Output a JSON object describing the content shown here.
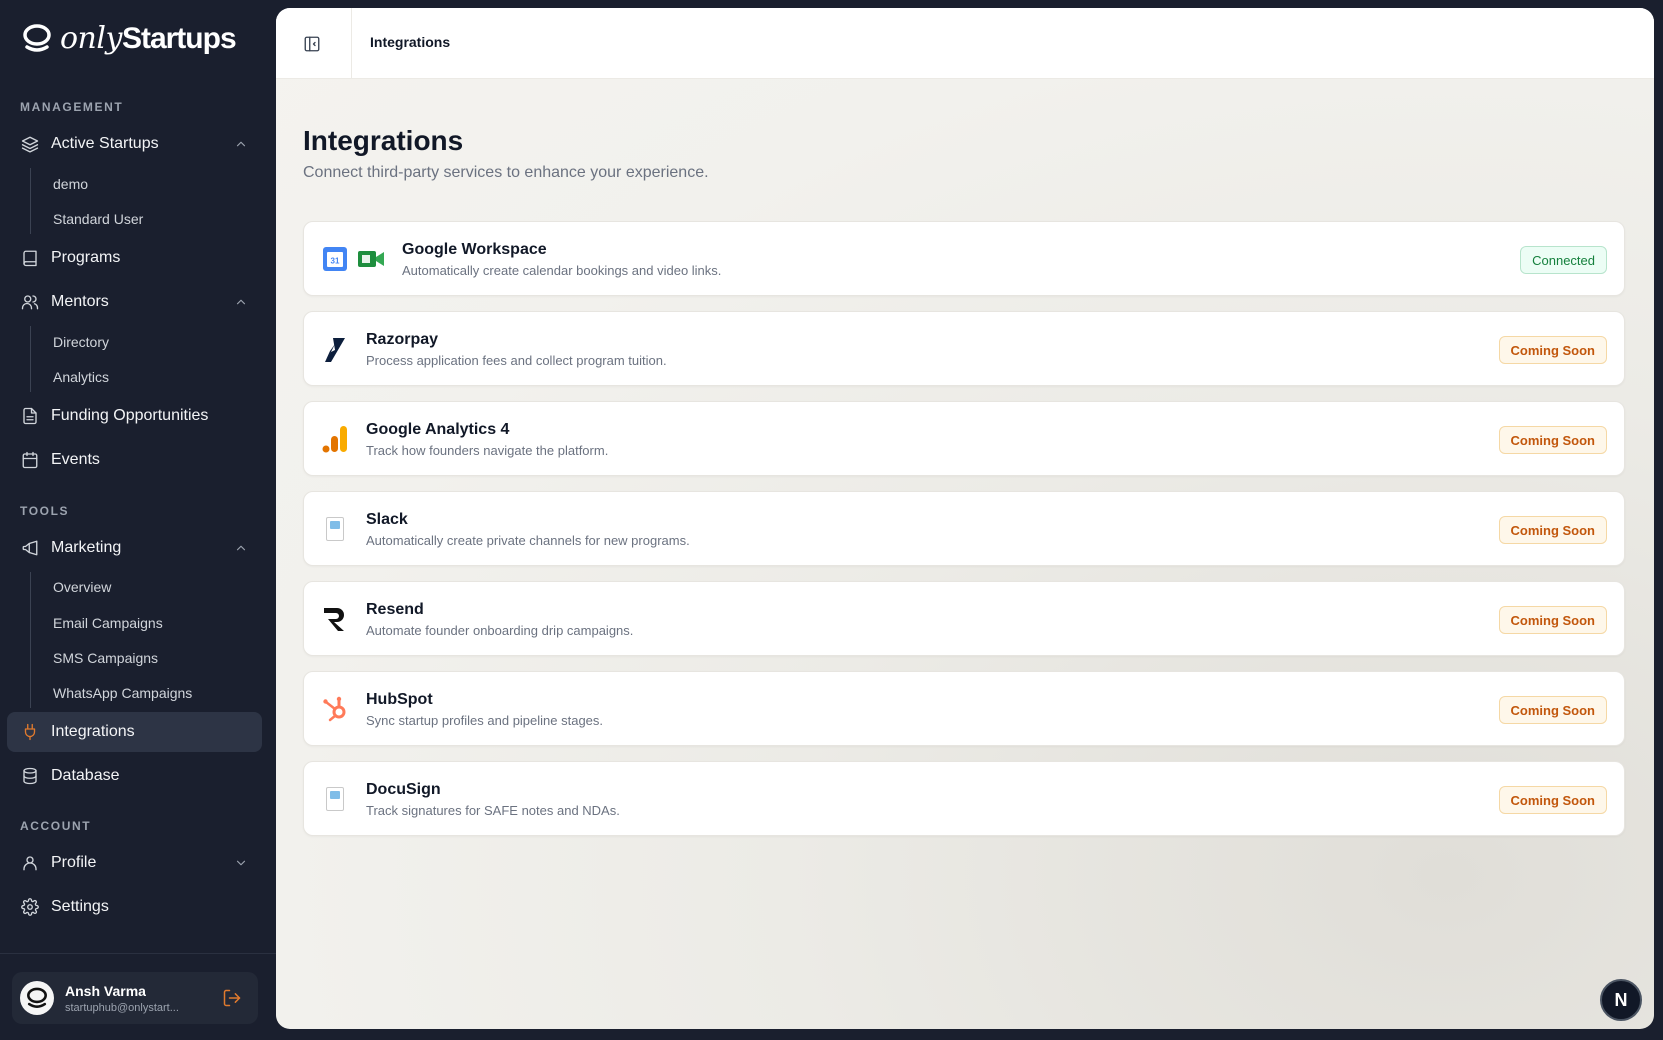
{
  "brand": {
    "only": "only",
    "startups": "Startups"
  },
  "sidebar": {
    "sections": {
      "management": "MANAGEMENT",
      "tools": "TOOLS",
      "account": "ACCOUNT"
    },
    "items": {
      "active_startups": "Active Startups",
      "programs": "Programs",
      "mentors": "Mentors",
      "funding": "Funding Opportunities",
      "events": "Events",
      "marketing": "Marketing",
      "integrations": "Integrations",
      "database": "Database",
      "profile": "Profile",
      "settings": "Settings"
    },
    "sub": {
      "startups": [
        "demo",
        "Standard User"
      ],
      "mentors": [
        "Directory",
        "Analytics"
      ],
      "marketing": [
        "Overview",
        "Email Campaigns",
        "SMS Campaigns",
        "WhatsApp Campaigns"
      ]
    },
    "user": {
      "name": "Ansh Varma",
      "email": "startuphub@onlystart..."
    }
  },
  "topbar": {
    "breadcrumb": "Integrations"
  },
  "page": {
    "title": "Integrations",
    "subtitle": "Connect third-party services to enhance your experience."
  },
  "integrations": [
    {
      "name": "Google Workspace",
      "desc": "Automatically create calendar bookings and video links.",
      "status": "Connected",
      "icon": "google-calendar-meet"
    },
    {
      "name": "Razorpay",
      "desc": "Process application fees and collect program tuition.",
      "status": "Coming Soon",
      "icon": "razorpay"
    },
    {
      "name": "Google Analytics 4",
      "desc": "Track how founders navigate the platform.",
      "status": "Coming Soon",
      "icon": "google-analytics"
    },
    {
      "name": "Slack",
      "desc": "Automatically create private channels for new programs.",
      "status": "Coming Soon",
      "icon": "broken-image"
    },
    {
      "name": "Resend",
      "desc": "Automate founder onboarding drip campaigns.",
      "status": "Coming Soon",
      "icon": "resend"
    },
    {
      "name": "HubSpot",
      "desc": "Sync startup profiles and pipeline stages.",
      "status": "Coming Soon",
      "icon": "hubspot"
    },
    {
      "name": "DocuSign",
      "desc": "Track signatures for SAFE notes and NDAs.",
      "status": "Coming Soon",
      "icon": "broken-image"
    }
  ],
  "fab": {
    "label": "N"
  },
  "colors": {
    "accent": "#e07a2e",
    "sidebar_bg": "#1a1f2e",
    "connected": "#15803d",
    "coming_soon": "#c2570c"
  }
}
